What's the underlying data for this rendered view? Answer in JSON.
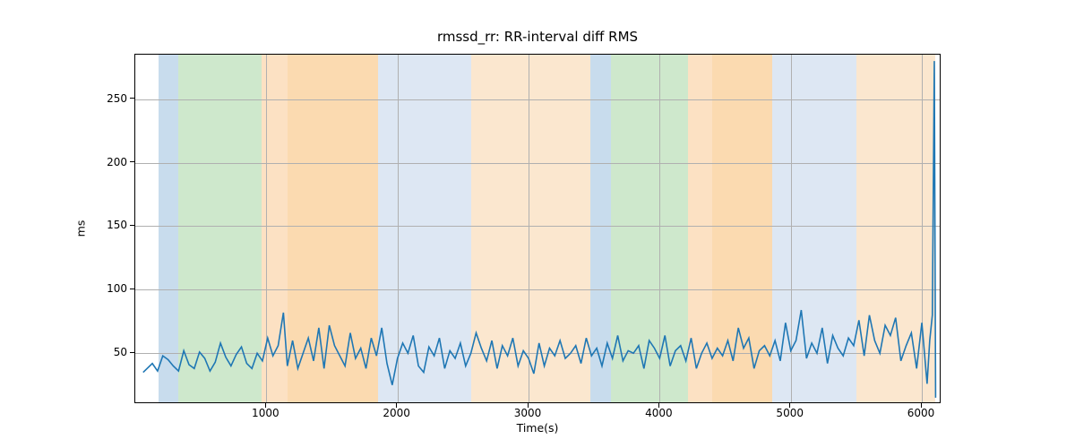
{
  "chart_data": {
    "type": "line",
    "title": "rmssd_rr: RR-interval diff RMS",
    "xlabel": "Time(s)",
    "ylabel": "ms",
    "xlim": [
      0,
      6150
    ],
    "ylim": [
      10,
      285
    ],
    "xticks": [
      1000,
      2000,
      3000,
      4000,
      5000,
      6000
    ],
    "yticks": [
      50,
      100,
      150,
      200,
      250
    ],
    "bands": [
      {
        "x0": 175,
        "x1": 325,
        "color": "#c8dced"
      },
      {
        "x0": 325,
        "x1": 965,
        "color": "#cee8cc"
      },
      {
        "x0": 965,
        "x1": 1165,
        "color": "#fce1c3"
      },
      {
        "x0": 1165,
        "x1": 1850,
        "color": "#fbdab0"
      },
      {
        "x0": 1850,
        "x1": 2560,
        "color": "#dde7f3"
      },
      {
        "x0": 2560,
        "x1": 3470,
        "color": "#fbe7cf"
      },
      {
        "x0": 3470,
        "x1": 3630,
        "color": "#c8dced"
      },
      {
        "x0": 3630,
        "x1": 4215,
        "color": "#cee8cc"
      },
      {
        "x0": 4215,
        "x1": 4400,
        "color": "#fce1c3"
      },
      {
        "x0": 4400,
        "x1": 4860,
        "color": "#fbdab0"
      },
      {
        "x0": 4860,
        "x1": 5500,
        "color": "#dde7f3"
      },
      {
        "x0": 5500,
        "x1": 6100,
        "color": "#fbe7cf"
      }
    ],
    "x": [
      60,
      90,
      130,
      170,
      210,
      250,
      290,
      330,
      370,
      410,
      450,
      490,
      530,
      570,
      610,
      650,
      690,
      730,
      770,
      810,
      850,
      890,
      930,
      970,
      1010,
      1050,
      1090,
      1130,
      1160,
      1200,
      1240,
      1280,
      1320,
      1360,
      1400,
      1440,
      1480,
      1520,
      1560,
      1600,
      1640,
      1680,
      1720,
      1760,
      1800,
      1840,
      1880,
      1920,
      1960,
      2000,
      2040,
      2080,
      2120,
      2160,
      2200,
      2240,
      2280,
      2320,
      2360,
      2400,
      2440,
      2480,
      2520,
      2560,
      2600,
      2640,
      2680,
      2720,
      2760,
      2800,
      2840,
      2880,
      2920,
      2960,
      3000,
      3040,
      3080,
      3120,
      3160,
      3200,
      3240,
      3280,
      3320,
      3360,
      3400,
      3440,
      3480,
      3520,
      3560,
      3600,
      3640,
      3680,
      3720,
      3760,
      3800,
      3840,
      3880,
      3920,
      3960,
      4000,
      4040,
      4080,
      4120,
      4160,
      4200,
      4240,
      4280,
      4320,
      4360,
      4400,
      4440,
      4480,
      4520,
      4560,
      4600,
      4640,
      4680,
      4720,
      4760,
      4800,
      4840,
      4880,
      4920,
      4960,
      5000,
      5040,
      5080,
      5120,
      5160,
      5200,
      5240,
      5280,
      5320,
      5360,
      5400,
      5440,
      5480,
      5520,
      5560,
      5600,
      5640,
      5680,
      5720,
      5760,
      5800,
      5840,
      5880,
      5920,
      5960,
      6000,
      6040,
      6060,
      6080,
      6095,
      6105
    ],
    "values": [
      35,
      38,
      42,
      36,
      48,
      45,
      40,
      36,
      52,
      41,
      38,
      51,
      46,
      36,
      43,
      58,
      47,
      40,
      49,
      55,
      42,
      38,
      50,
      44,
      62,
      48,
      56,
      82,
      40,
      60,
      38,
      50,
      62,
      44,
      70,
      38,
      72,
      56,
      48,
      40,
      66,
      46,
      54,
      38,
      62,
      48,
      70,
      42,
      25,
      46,
      58,
      50,
      64,
      40,
      35,
      55,
      48,
      62,
      38,
      52,
      46,
      58,
      40,
      50,
      66,
      54,
      44,
      60,
      38,
      56,
      48,
      62,
      40,
      52,
      46,
      34,
      58,
      40,
      54,
      48,
      60,
      46,
      50,
      56,
      42,
      62,
      48,
      54,
      40,
      58,
      46,
      64,
      44,
      52,
      50,
      56,
      38,
      60,
      54,
      46,
      64,
      40,
      52,
      56,
      44,
      62,
      38,
      50,
      58,
      46,
      54,
      48,
      60,
      44,
      70,
      54,
      62,
      38,
      52,
      56,
      48,
      60,
      44,
      74,
      52,
      60,
      84,
      46,
      58,
      50,
      70,
      42,
      64,
      54,
      48,
      62,
      56,
      76,
      48,
      80,
      60,
      50,
      72,
      64,
      78,
      44,
      56,
      66,
      38,
      74,
      26,
      60,
      80,
      280,
      15
    ]
  }
}
